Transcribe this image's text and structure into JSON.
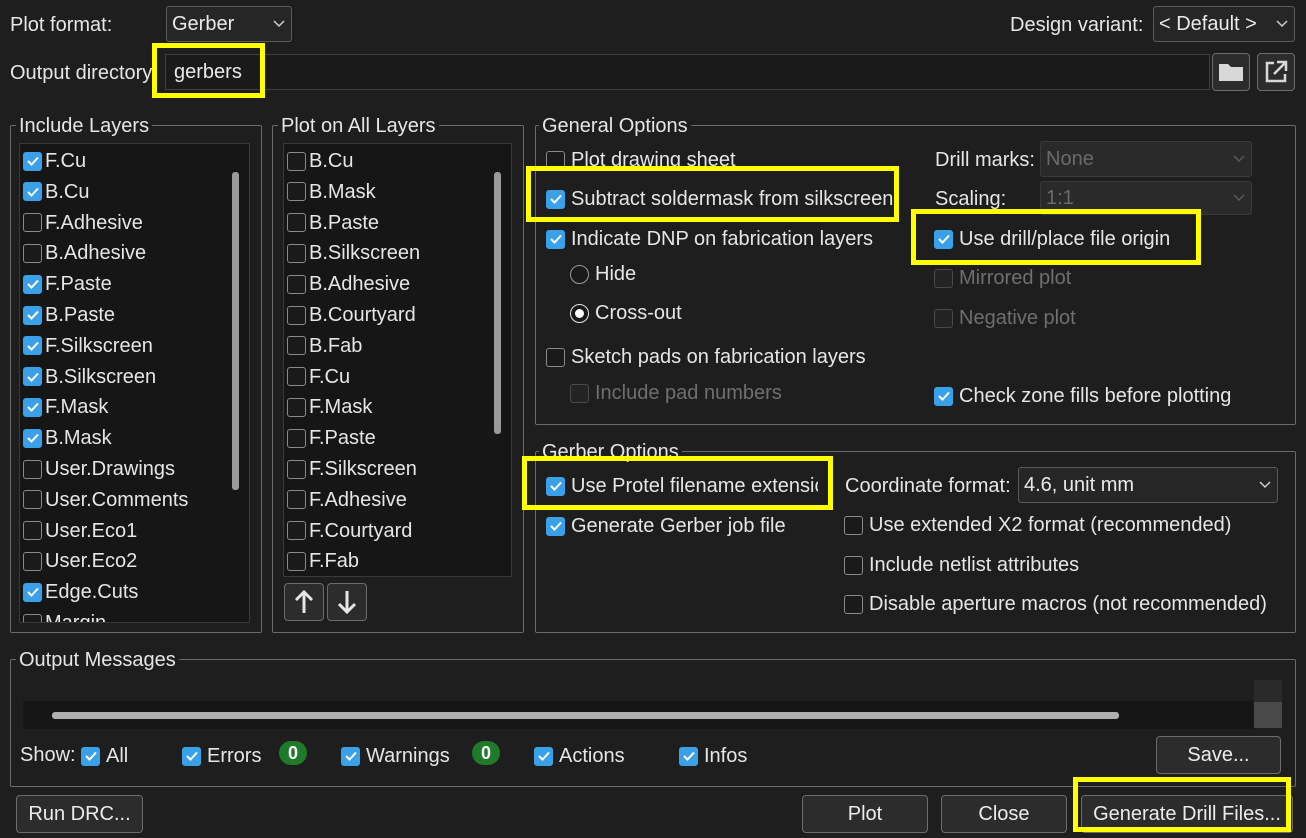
{
  "top": {
    "plot_format_label": "Plot format:",
    "plot_format_value": "Gerber",
    "design_variant_label": "Design variant:",
    "design_variant_value": "< Default >",
    "output_dir_label": "Output directory:",
    "output_dir_value": "gerbers"
  },
  "include_layers": {
    "title": "Include Layers",
    "items": [
      {
        "label": "F.Cu",
        "checked": true
      },
      {
        "label": "B.Cu",
        "checked": true
      },
      {
        "label": "F.Adhesive",
        "checked": false
      },
      {
        "label": "B.Adhesive",
        "checked": false
      },
      {
        "label": "F.Paste",
        "checked": true
      },
      {
        "label": "B.Paste",
        "checked": true
      },
      {
        "label": "F.Silkscreen",
        "checked": true
      },
      {
        "label": "B.Silkscreen",
        "checked": true
      },
      {
        "label": "F.Mask",
        "checked": true
      },
      {
        "label": "B.Mask",
        "checked": true
      },
      {
        "label": "User.Drawings",
        "checked": false
      },
      {
        "label": "User.Comments",
        "checked": false
      },
      {
        "label": "User.Eco1",
        "checked": false
      },
      {
        "label": "User.Eco2",
        "checked": false
      },
      {
        "label": "Edge.Cuts",
        "checked": true
      },
      {
        "label": "Margin",
        "checked": false
      }
    ]
  },
  "plot_all_layers": {
    "title": "Plot on All Layers",
    "items": [
      {
        "label": "B.Cu",
        "checked": false
      },
      {
        "label": "B.Mask",
        "checked": false
      },
      {
        "label": "B.Paste",
        "checked": false
      },
      {
        "label": "B.Silkscreen",
        "checked": false
      },
      {
        "label": "B.Adhesive",
        "checked": false
      },
      {
        "label": "B.Courtyard",
        "checked": false
      },
      {
        "label": "B.Fab",
        "checked": false
      },
      {
        "label": "F.Cu",
        "checked": false
      },
      {
        "label": "F.Mask",
        "checked": false
      },
      {
        "label": "F.Paste",
        "checked": false
      },
      {
        "label": "F.Silkscreen",
        "checked": false
      },
      {
        "label": "F.Adhesive",
        "checked": false
      },
      {
        "label": "F.Courtyard",
        "checked": false
      },
      {
        "label": "F.Fab",
        "checked": false
      }
    ]
  },
  "general": {
    "title": "General Options",
    "plot_drawing_sheet": "Plot drawing sheet",
    "subtract_soldermask": "Subtract soldermask from silkscreen",
    "indicate_dnp": "Indicate DNP on fabrication layers",
    "hide": "Hide",
    "cross_out": "Cross-out",
    "sketch_pads": "Sketch pads on fabrication layers",
    "include_pad_numbers": "Include pad numbers",
    "drill_marks_label": "Drill marks:",
    "drill_marks_value": "None",
    "scaling_label": "Scaling:",
    "scaling_value": "1:1",
    "use_drill_origin": "Use drill/place file origin",
    "mirrored_plot": "Mirrored plot",
    "negative_plot": "Negative plot",
    "check_zone_fills": "Check zone fills before plotting"
  },
  "gerber": {
    "title": "Gerber Options",
    "use_protel": "Use Protel filename extensic",
    "generate_job": "Generate Gerber job file",
    "coord_format_label": "Coordinate format:",
    "coord_format_value": "4.6, unit mm",
    "use_x2": "Use extended X2 format (recommended)",
    "include_netlist": "Include netlist attributes",
    "disable_aperture": "Disable aperture macros (not recommended)"
  },
  "messages": {
    "title": "Output Messages",
    "show_label": "Show:",
    "all": "All",
    "errors": "Errors",
    "errors_count": "0",
    "warnings": "Warnings",
    "warnings_count": "0",
    "actions": "Actions",
    "infos": "Infos",
    "save": "Save..."
  },
  "footer": {
    "run_drc": "Run DRC...",
    "plot": "Plot",
    "close": "Close",
    "generate_drill": "Generate Drill Files..."
  },
  "colors": {
    "accent": "#3aa0e8",
    "highlight": "#ffff00",
    "badge": "#1f7a2a"
  }
}
